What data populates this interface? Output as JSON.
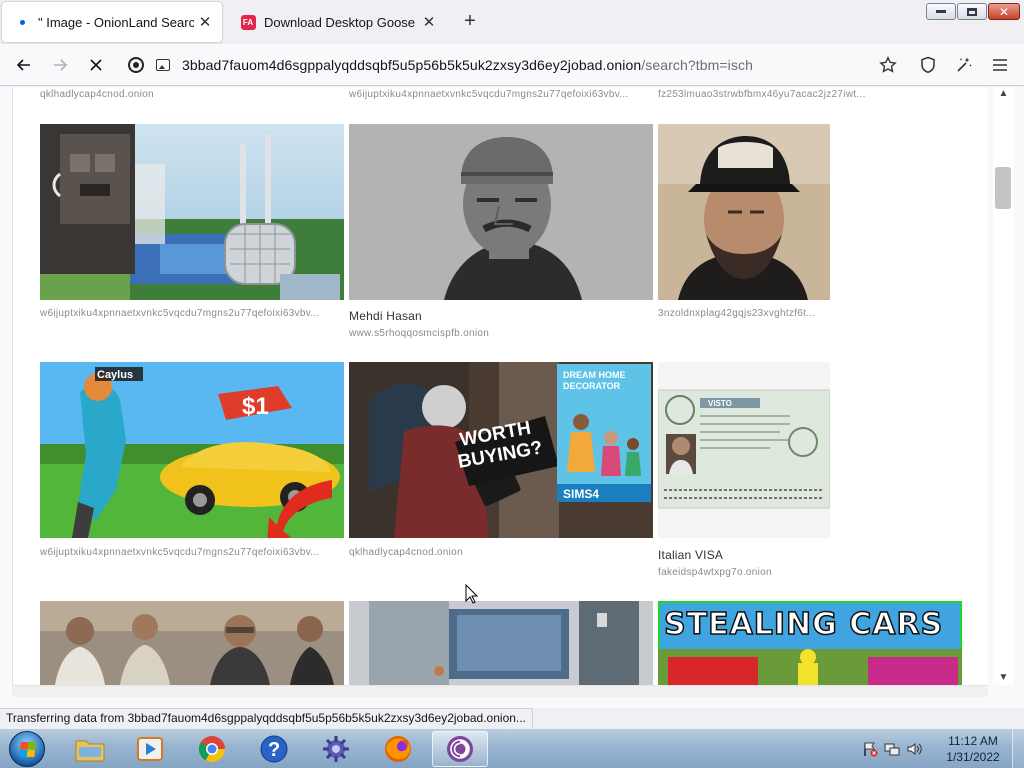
{
  "tabs": [
    {
      "title": "\" Image - OnionLand Search",
      "active": true,
      "loading": true
    },
    {
      "title": "Download Desktop Goose by sa",
      "active": false
    }
  ],
  "window_controls": {
    "minimize": "–",
    "maximize": "□",
    "close": "✕"
  },
  "nav": {
    "back_icon": "arrow-left-icon",
    "forward_icon": "arrow-right-icon",
    "stop_icon": "close-icon",
    "url_host": "3bbad7fauom4d6sgppalyqddsqbf5u5p56b5k5uk2zxsy3d6ey2jobad.onion",
    "url_path": "/search?tbm=isch",
    "bookmark_icon": "star-icon",
    "shield_icon": "shield-icon",
    "magic_icon": "wand-icon",
    "menu_icon": "hamburger-icon"
  },
  "results": {
    "top_captions": [
      "qklhadlycap4cnod.onion",
      "w6ijuptxiku4xpnnaetxvnkc5vqcdu7mgns2u77qefoixi63vbv...",
      "fz253lmuao3strwbfbmx46yu7acac2jz27iwt..."
    ],
    "row1": [
      {
        "site": "w6ijuptxiku4xpnnaetxvnkc5vqcdu7mgns2u77qefoixi63vbv...",
        "title": ""
      },
      {
        "title": "Mehdi Hasan",
        "site": "www.s5rhoqqosmcispfb.onion"
      },
      {
        "site": "3nzoldnxplag42gqjs23xvghtzf6t...",
        "title": ""
      }
    ],
    "row2": [
      {
        "site": "w6ijuptxiku4xpnnaetxvnkc5vqcdu7mgns2u77qefoixi63vbv...",
        "title": "",
        "image_text": [
          "Caylus",
          "$1"
        ]
      },
      {
        "site": "qklhadlycap4cnod.onion",
        "title": "",
        "image_text": [
          "WORTH",
          "BUYING?",
          "DREAM HOME",
          "DECORATOR",
          "SIMS4"
        ]
      },
      {
        "title": "Italian VISA",
        "site": "fakeidsp4wtxpg7o.onion",
        "image_text": [
          "VISTO"
        ]
      }
    ],
    "row3": [
      {
        "image_text": ""
      },
      {
        "image_text": ""
      },
      {
        "image_text": "STEALING CARS"
      }
    ]
  },
  "status_bar": "Transferring data from 3bbad7fauom4d6sgppalyqddsqbf5u5p56b5k5uk2zxsy3d6ey2jobad.onion...",
  "taskbar": {
    "apps": [
      {
        "name": "windows-explorer",
        "icon": "folder-icon"
      },
      {
        "name": "media-player",
        "icon": "media-player-icon"
      },
      {
        "name": "chrome",
        "icon": "chrome-icon"
      },
      {
        "name": "help",
        "icon": "help-icon",
        "label": "?"
      },
      {
        "name": "tool",
        "icon": "gear-icon"
      },
      {
        "name": "firefox",
        "icon": "firefox-icon"
      },
      {
        "name": "tor-browser",
        "icon": "tor-icon",
        "active": true
      }
    ],
    "clock_time": "11:12 AM",
    "clock_date": "1/31/2022"
  },
  "colors": {
    "accent": "#0060df",
    "taskbar": "#98b4cf",
    "page_bg": "#ffffff"
  }
}
